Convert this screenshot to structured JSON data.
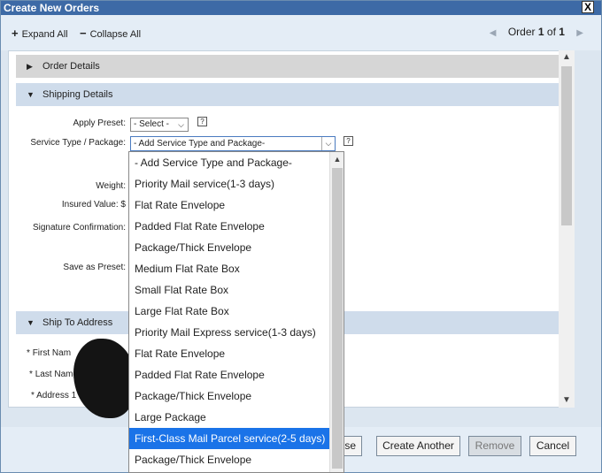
{
  "window": {
    "title": "Create New Orders",
    "close": "X"
  },
  "toolbar": {
    "expand_all": "Expand All",
    "collapse_all": "Collapse All",
    "order_prefix": "Order",
    "order_current": "1",
    "order_of": "of",
    "order_total": "1"
  },
  "sections": {
    "order_details": "Order Details",
    "shipping_details": "Shipping Details",
    "ship_to_address": "Ship To Address"
  },
  "shipping": {
    "apply_preset_label": "Apply Preset:",
    "apply_preset_value": "- Select -",
    "service_label": "Service Type / Package:",
    "service_value": "- Add Service Type and Package-",
    "weight_label": "Weight:",
    "insured_label": "Insured Value: $",
    "signature_label": "Signature Confirmation:",
    "save_preset_label": "Save as Preset:",
    "help": "?"
  },
  "address": {
    "first_name": "First Nam",
    "last_name": "Last Name",
    "address1": "Address 1",
    "req": "*"
  },
  "dropdown": {
    "options": [
      "- Add Service Type and Package-",
      "Priority Mail service(1-3 days)",
      "Flat Rate Envelope",
      "Padded Flat Rate Envelope",
      "Package/Thick Envelope",
      "Medium Flat Rate Box",
      "Small Flat Rate Box",
      "Large Flat Rate Box",
      "Priority Mail Express service(1-3 days)",
      "Flat Rate Envelope",
      "Padded Flat Rate Envelope",
      "Package/Thick Envelope",
      "Large Package",
      "First-Class Mail Parcel service(2-5 days)",
      "Package/Thick Envelope"
    ],
    "selected_index": 13
  },
  "footer": {
    "close_partial": "ose",
    "create_another": "Create Another",
    "remove": "Remove",
    "cancel": "Cancel"
  },
  "colors": {
    "titlebar": "#3d6aa6",
    "selected": "#1a73e8"
  }
}
